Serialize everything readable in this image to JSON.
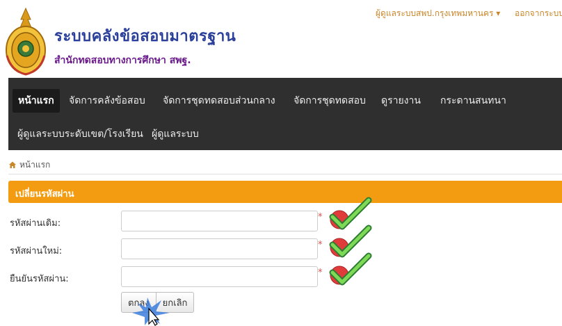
{
  "header": {
    "title": "ระบบคลังข้อสอบมาตรฐาน",
    "subtitle": "สำนักทดสอบทางการศึกษา สพฐ.",
    "user_menu": "ผู้ดูแลระบบสพป.กรุงเทพมหานคร ▾",
    "logout": "ออกจากระบบ"
  },
  "navbar": {
    "items": [
      {
        "label": "หน้าแรก",
        "active": true
      },
      {
        "label": "จัดการคลังข้อสอบ"
      },
      {
        "label": "จัดการชุดทดสอบส่วนกลาง"
      },
      {
        "label": "จัดการชุดทดสอบ"
      },
      {
        "label": "ดูรายงาน"
      },
      {
        "label": "กระดานสนทนา"
      },
      {
        "label": "ผู้ดูแลระบบระดับเขต/โรงเรียน"
      },
      {
        "label": "ผู้ดูแลระบบ"
      }
    ]
  },
  "breadcrumb": {
    "home": "หน้าแรก"
  },
  "panel": {
    "title": "เปลี่ยนรหัสผ่าน"
  },
  "form": {
    "fields": [
      {
        "label": "รหัสผ่านเดิม:",
        "value": "",
        "required": "*"
      },
      {
        "label": "รหัสผ่านใหม่:",
        "value": "",
        "required": "*"
      },
      {
        "label": "ยืนยันรหัสผ่าน:",
        "value": "",
        "required": "*"
      }
    ],
    "submit": "ตกลง",
    "cancel": "ยกเลิก"
  },
  "icons": {
    "home": "home-icon",
    "valid": "valid-check-icon",
    "cursor": "mouse-pointer-icon"
  },
  "colors": {
    "accent": "#f39c12",
    "navbar": "#2f2f2f",
    "required": "#d9534f",
    "valid": "#4caf2a",
    "title": "#2a3f9a"
  }
}
